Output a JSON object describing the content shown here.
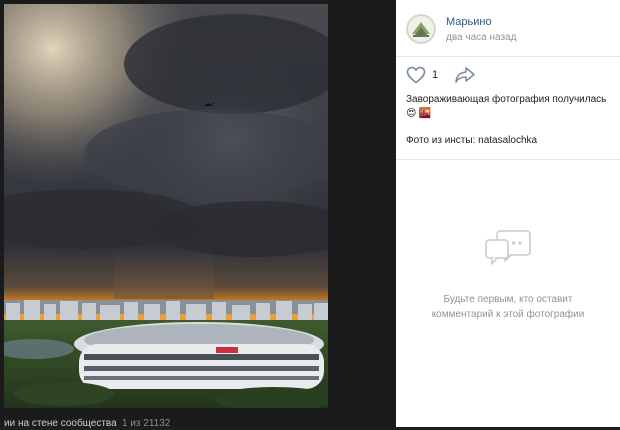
{
  "viewer": {
    "caption": "ии на стене сообщества",
    "counter": "1 из 21132"
  },
  "post": {
    "author": "Марьино",
    "time": "два часа назад",
    "likes": "1",
    "text_line1": "Завораживающая фотография получилась",
    "emoji1": "😍",
    "emoji2": "🌇",
    "source": "Фото из инсты: natasalochka"
  },
  "comments": {
    "empty_line1": "Будьте первым, кто оставит",
    "empty_line2": "комментарий к этой фотографии"
  },
  "icons": {
    "like": "heart-outline-icon",
    "share": "share-arrow-icon",
    "comments": "speech-bubble-dots-icon"
  },
  "colors": {
    "link": "#2a5885",
    "muted": "#939393",
    "viewer_bg": "#1b1b1b"
  }
}
